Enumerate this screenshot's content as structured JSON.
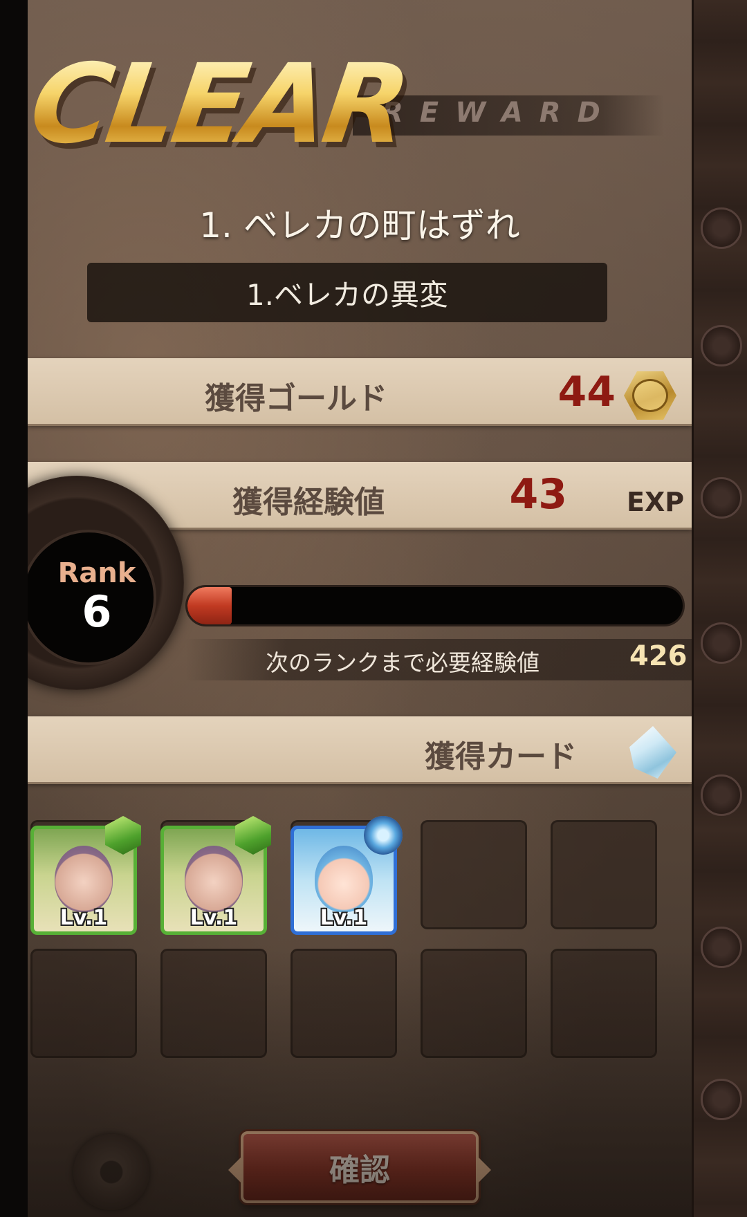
{
  "header": {
    "clear_title": "CLEAR",
    "reward_subtitle": "REWARD"
  },
  "stage": {
    "title": "1. ベレカの町はずれ",
    "subtitle": "1.ベレカの異変"
  },
  "rewards": {
    "gold_label": "獲得ゴールド",
    "gold_value": "44",
    "exp_label": "獲得経験値",
    "exp_value": "43",
    "exp_unit": "EXP"
  },
  "rank": {
    "label": "Rank",
    "value": "6",
    "progress_fraction": 0.09,
    "next_label": "次のランクまで必要経験値",
    "next_value": "426"
  },
  "cards": {
    "label": "獲得カード",
    "items": [
      {
        "level": "Lv.1",
        "element": "leaf",
        "frame": "green"
      },
      {
        "level": "Lv.1",
        "element": "leaf",
        "frame": "green"
      },
      {
        "level": "Lv.1",
        "element": "ice",
        "frame": "blue"
      }
    ]
  },
  "footer": {
    "confirm_label": "確認"
  },
  "colors": {
    "value_red": "#8e1a12",
    "bar_fill": "#c13a22",
    "clear_gold": "#f2c64c",
    "button_red": "#8e3326"
  }
}
